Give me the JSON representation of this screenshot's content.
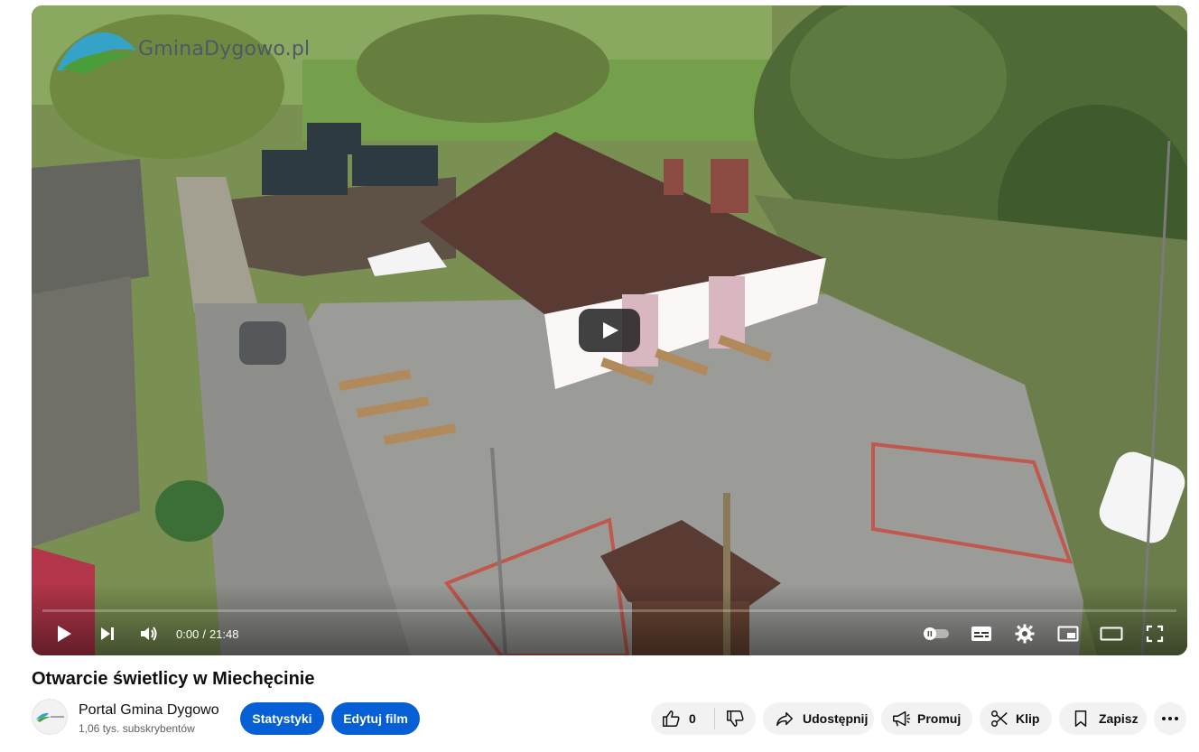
{
  "video": {
    "watermark": "GminaDygowo.pl",
    "current_time": "0:00",
    "separator": "/",
    "duration": "21:48",
    "progress": 0,
    "accent": "#ff0000"
  },
  "info": {
    "title": "Otwarcie świetlicy w Miechęcinie",
    "channel_name": "Portal Gmina Dygowo",
    "subscribers": "1,06 tys. subskrybentów",
    "stats_button": "Statystyki",
    "edit_button": "Edytuj film",
    "like_count": "0",
    "share_label": "Udostępnij",
    "promote_label": "Promuj",
    "clip_label": "Klip",
    "save_label": "Zapisz"
  },
  "colors": {
    "primary_button": "#065fd4",
    "chip_bg": "#f2f2f2"
  },
  "icons": {
    "play": "play-icon",
    "next": "next-icon",
    "volume": "volume-icon",
    "autoplay": "autoplay-toggle-icon",
    "subtitles": "subtitles-icon",
    "settings": "gear-icon",
    "miniplayer": "miniplayer-icon",
    "theater": "theater-icon",
    "fullscreen": "fullscreen-icon",
    "like": "thumbs-up-icon",
    "dislike": "thumbs-down-icon",
    "share": "share-icon",
    "promote": "megaphone-icon",
    "clip": "scissors-icon",
    "save": "bookmark-icon",
    "more": "more-icon"
  }
}
